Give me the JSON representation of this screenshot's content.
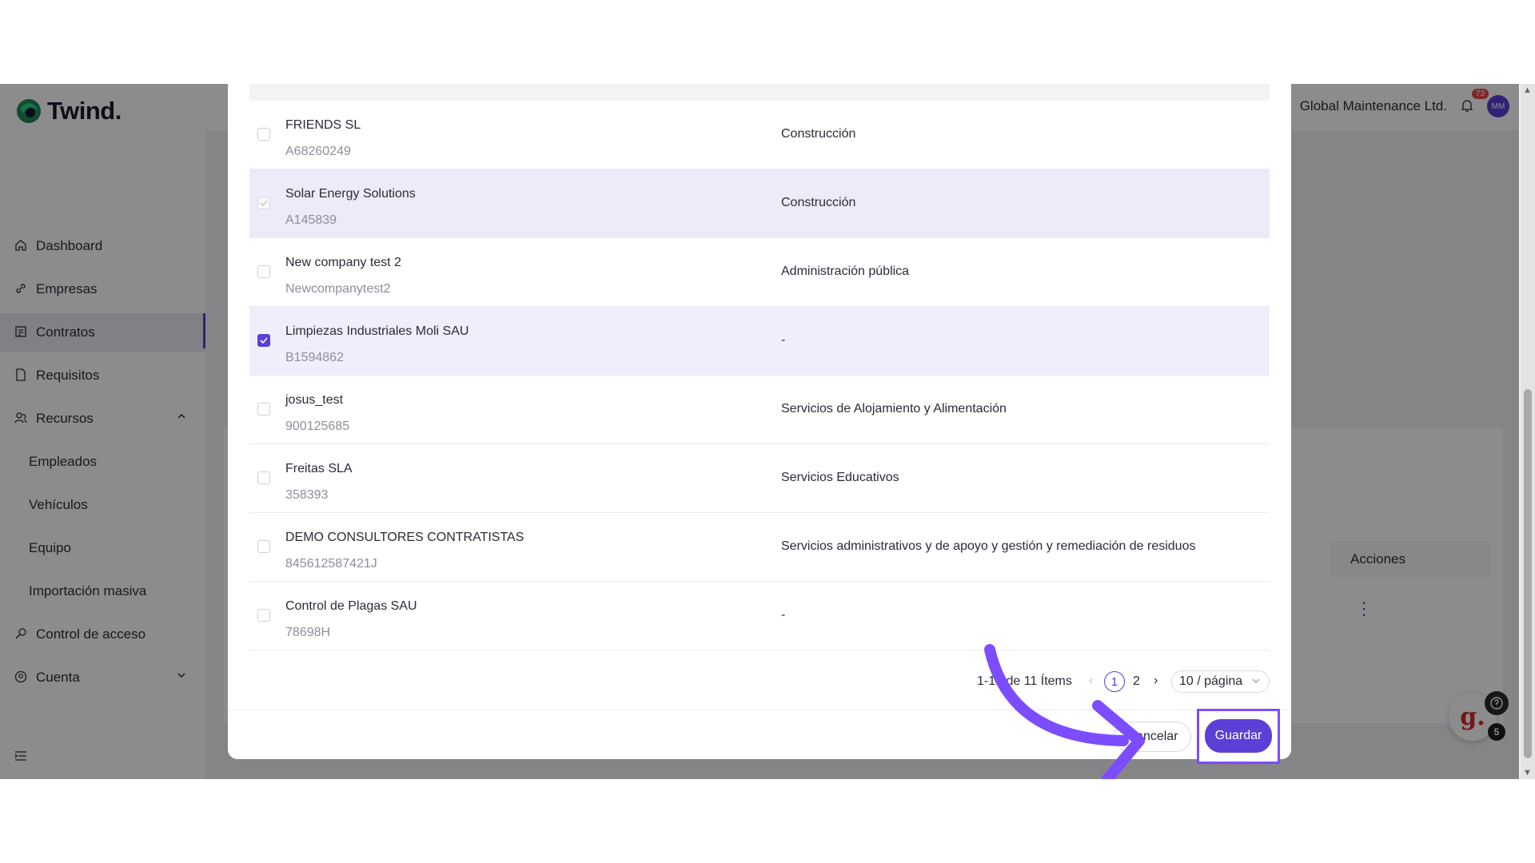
{
  "app": {
    "logo_text": "Twind."
  },
  "sidebar": {
    "items": [
      {
        "label": "Dashboard",
        "icon": "home-icon"
      },
      {
        "label": "Empresas",
        "icon": "link-icon"
      },
      {
        "label": "Contratos",
        "icon": "contract-icon",
        "active": true
      },
      {
        "label": "Requisitos",
        "icon": "file-icon"
      },
      {
        "label": "Recursos",
        "icon": "people-icon",
        "expanded": true
      },
      {
        "label": "Empleados",
        "sub": true
      },
      {
        "label": "Vehículos",
        "sub": true
      },
      {
        "label": "Equipo",
        "sub": true
      },
      {
        "label": "Importación masiva",
        "sub": true
      },
      {
        "label": "Control de acceso",
        "icon": "key-icon"
      },
      {
        "label": "Cuenta",
        "icon": "account-icon"
      }
    ]
  },
  "header": {
    "organization": "Global Maintenance Ltd.",
    "notifications_count": "73",
    "avatar_initials": "MM"
  },
  "background_table": {
    "actions_header": "Acciones"
  },
  "modal": {
    "rows": [
      {
        "name": "FRIENDS SL",
        "id": "A68260249",
        "sector": "Construcción",
        "checked": false
      },
      {
        "name": "Solar Energy Solutions",
        "id": "A145839",
        "sector": "Construcción",
        "checked": false,
        "state": "disabled-checked"
      },
      {
        "name": "New company test 2",
        "id": "Newcompanytest2",
        "sector": "Administración pública",
        "checked": false
      },
      {
        "name": "Limpiezas Industriales Moli SAU",
        "id": "B1594862",
        "sector": "-",
        "checked": true
      },
      {
        "name": "josus_test",
        "id": "900125685",
        "sector": "Servicios de Alojamiento y Alimentación",
        "checked": false
      },
      {
        "name": "Freitas SLA",
        "id": "358393",
        "sector": "Servicios Educativos",
        "checked": false
      },
      {
        "name": "DEMO CONSULTORES CONTRATISTAS",
        "id": "845612587421J",
        "sector": "Servicios administrativos y de apoyo y gestión y remediación de residuos",
        "checked": false
      },
      {
        "name": "Control de Plagas SAU",
        "id": "78698H",
        "sector": "-",
        "checked": false
      }
    ],
    "pagination": {
      "info": "1-10 de 11 Ítems",
      "pages": [
        "1",
        "2"
      ],
      "current_page": "1",
      "page_size": "10 / página"
    },
    "footer": {
      "cancel_label": "Cancelar",
      "save_label": "Guardar"
    }
  },
  "help_widget": {
    "count": "5",
    "logo_letter": "g."
  },
  "colors": {
    "accent": "#5b3fd6",
    "highlight": "#7c4dff",
    "badge": "#e5484d"
  }
}
